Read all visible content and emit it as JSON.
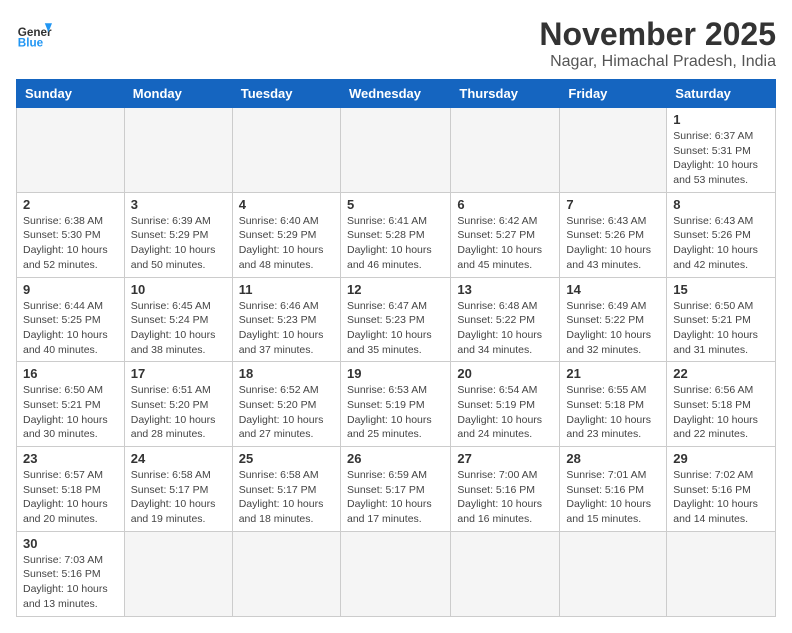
{
  "header": {
    "logo_general": "General",
    "logo_blue": "Blue",
    "month_year": "November 2025",
    "location": "Nagar, Himachal Pradesh, India"
  },
  "weekdays": [
    "Sunday",
    "Monday",
    "Tuesday",
    "Wednesday",
    "Thursday",
    "Friday",
    "Saturday"
  ],
  "days": {
    "d1": {
      "num": "1",
      "sunrise": "Sunrise: 6:37 AM",
      "sunset": "Sunset: 5:31 PM",
      "daylight": "Daylight: 10 hours and 53 minutes."
    },
    "d2": {
      "num": "2",
      "sunrise": "Sunrise: 6:38 AM",
      "sunset": "Sunset: 5:30 PM",
      "daylight": "Daylight: 10 hours and 52 minutes."
    },
    "d3": {
      "num": "3",
      "sunrise": "Sunrise: 6:39 AM",
      "sunset": "Sunset: 5:29 PM",
      "daylight": "Daylight: 10 hours and 50 minutes."
    },
    "d4": {
      "num": "4",
      "sunrise": "Sunrise: 6:40 AM",
      "sunset": "Sunset: 5:29 PM",
      "daylight": "Daylight: 10 hours and 48 minutes."
    },
    "d5": {
      "num": "5",
      "sunrise": "Sunrise: 6:41 AM",
      "sunset": "Sunset: 5:28 PM",
      "daylight": "Daylight: 10 hours and 46 minutes."
    },
    "d6": {
      "num": "6",
      "sunrise": "Sunrise: 6:42 AM",
      "sunset": "Sunset: 5:27 PM",
      "daylight": "Daylight: 10 hours and 45 minutes."
    },
    "d7": {
      "num": "7",
      "sunrise": "Sunrise: 6:43 AM",
      "sunset": "Sunset: 5:26 PM",
      "daylight": "Daylight: 10 hours and 43 minutes."
    },
    "d8": {
      "num": "8",
      "sunrise": "Sunrise: 6:43 AM",
      "sunset": "Sunset: 5:26 PM",
      "daylight": "Daylight: 10 hours and 42 minutes."
    },
    "d9": {
      "num": "9",
      "sunrise": "Sunrise: 6:44 AM",
      "sunset": "Sunset: 5:25 PM",
      "daylight": "Daylight: 10 hours and 40 minutes."
    },
    "d10": {
      "num": "10",
      "sunrise": "Sunrise: 6:45 AM",
      "sunset": "Sunset: 5:24 PM",
      "daylight": "Daylight: 10 hours and 38 minutes."
    },
    "d11": {
      "num": "11",
      "sunrise": "Sunrise: 6:46 AM",
      "sunset": "Sunset: 5:23 PM",
      "daylight": "Daylight: 10 hours and 37 minutes."
    },
    "d12": {
      "num": "12",
      "sunrise": "Sunrise: 6:47 AM",
      "sunset": "Sunset: 5:23 PM",
      "daylight": "Daylight: 10 hours and 35 minutes."
    },
    "d13": {
      "num": "13",
      "sunrise": "Sunrise: 6:48 AM",
      "sunset": "Sunset: 5:22 PM",
      "daylight": "Daylight: 10 hours and 34 minutes."
    },
    "d14": {
      "num": "14",
      "sunrise": "Sunrise: 6:49 AM",
      "sunset": "Sunset: 5:22 PM",
      "daylight": "Daylight: 10 hours and 32 minutes."
    },
    "d15": {
      "num": "15",
      "sunrise": "Sunrise: 6:50 AM",
      "sunset": "Sunset: 5:21 PM",
      "daylight": "Daylight: 10 hours and 31 minutes."
    },
    "d16": {
      "num": "16",
      "sunrise": "Sunrise: 6:50 AM",
      "sunset": "Sunset: 5:21 PM",
      "daylight": "Daylight: 10 hours and 30 minutes."
    },
    "d17": {
      "num": "17",
      "sunrise": "Sunrise: 6:51 AM",
      "sunset": "Sunset: 5:20 PM",
      "daylight": "Daylight: 10 hours and 28 minutes."
    },
    "d18": {
      "num": "18",
      "sunrise": "Sunrise: 6:52 AM",
      "sunset": "Sunset: 5:20 PM",
      "daylight": "Daylight: 10 hours and 27 minutes."
    },
    "d19": {
      "num": "19",
      "sunrise": "Sunrise: 6:53 AM",
      "sunset": "Sunset: 5:19 PM",
      "daylight": "Daylight: 10 hours and 25 minutes."
    },
    "d20": {
      "num": "20",
      "sunrise": "Sunrise: 6:54 AM",
      "sunset": "Sunset: 5:19 PM",
      "daylight": "Daylight: 10 hours and 24 minutes."
    },
    "d21": {
      "num": "21",
      "sunrise": "Sunrise: 6:55 AM",
      "sunset": "Sunset: 5:18 PM",
      "daylight": "Daylight: 10 hours and 23 minutes."
    },
    "d22": {
      "num": "22",
      "sunrise": "Sunrise: 6:56 AM",
      "sunset": "Sunset: 5:18 PM",
      "daylight": "Daylight: 10 hours and 22 minutes."
    },
    "d23": {
      "num": "23",
      "sunrise": "Sunrise: 6:57 AM",
      "sunset": "Sunset: 5:18 PM",
      "daylight": "Daylight: 10 hours and 20 minutes."
    },
    "d24": {
      "num": "24",
      "sunrise": "Sunrise: 6:58 AM",
      "sunset": "Sunset: 5:17 PM",
      "daylight": "Daylight: 10 hours and 19 minutes."
    },
    "d25": {
      "num": "25",
      "sunrise": "Sunrise: 6:58 AM",
      "sunset": "Sunset: 5:17 PM",
      "daylight": "Daylight: 10 hours and 18 minutes."
    },
    "d26": {
      "num": "26",
      "sunrise": "Sunrise: 6:59 AM",
      "sunset": "Sunset: 5:17 PM",
      "daylight": "Daylight: 10 hours and 17 minutes."
    },
    "d27": {
      "num": "27",
      "sunrise": "Sunrise: 7:00 AM",
      "sunset": "Sunset: 5:16 PM",
      "daylight": "Daylight: 10 hours and 16 minutes."
    },
    "d28": {
      "num": "28",
      "sunrise": "Sunrise: 7:01 AM",
      "sunset": "Sunset: 5:16 PM",
      "daylight": "Daylight: 10 hours and 15 minutes."
    },
    "d29": {
      "num": "29",
      "sunrise": "Sunrise: 7:02 AM",
      "sunset": "Sunset: 5:16 PM",
      "daylight": "Daylight: 10 hours and 14 minutes."
    },
    "d30": {
      "num": "30",
      "sunrise": "Sunrise: 7:03 AM",
      "sunset": "Sunset: 5:16 PM",
      "daylight": "Daylight: 10 hours and 13 minutes."
    }
  }
}
